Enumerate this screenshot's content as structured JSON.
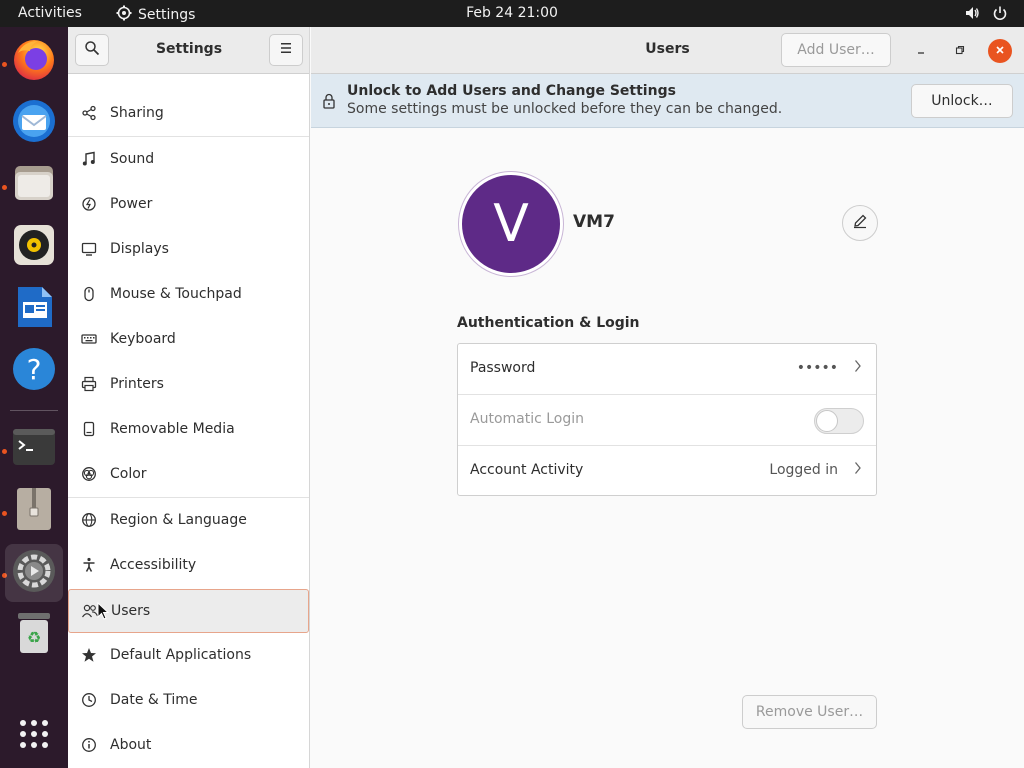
{
  "topbar": {
    "activities": "Activities",
    "app_name": "Settings",
    "clock": "Feb 24  21:00",
    "tray_icons": [
      "volume-icon",
      "power-icon"
    ]
  },
  "dock": {
    "items": [
      {
        "name": "Firefox",
        "icon": "firefox-icon",
        "running": true
      },
      {
        "name": "Thunderbird",
        "icon": "thunderbird-icon",
        "running": false
      },
      {
        "name": "Files",
        "icon": "files-icon",
        "running": true
      },
      {
        "name": "Rhythmbox",
        "icon": "rhythmbox-icon",
        "running": false
      },
      {
        "name": "LibreOffice Writer",
        "icon": "writer-icon",
        "running": false
      },
      {
        "name": "Help",
        "icon": "help-icon",
        "running": false
      },
      {
        "name": "Terminal",
        "icon": "terminal-icon",
        "running": true
      },
      {
        "name": "Archive Manager",
        "icon": "archive-icon",
        "running": true
      },
      {
        "name": "Settings",
        "icon": "settings-icon",
        "running": true,
        "active": true
      },
      {
        "name": "Trash",
        "icon": "trash-icon",
        "running": false
      }
    ],
    "show_apps": "app-grid-icon"
  },
  "sidebar": {
    "title": "Settings",
    "items": [
      {
        "label": "Sharing",
        "icon": "share-icon"
      },
      {
        "label": "Sound",
        "icon": "music-note-icon"
      },
      {
        "label": "Power",
        "icon": "power-icon"
      },
      {
        "label": "Displays",
        "icon": "display-icon"
      },
      {
        "label": "Mouse & Touchpad",
        "icon": "mouse-icon"
      },
      {
        "label": "Keyboard",
        "icon": "keyboard-icon"
      },
      {
        "label": "Printers",
        "icon": "printer-icon"
      },
      {
        "label": "Removable Media",
        "icon": "removable-media-icon"
      },
      {
        "label": "Color",
        "icon": "color-icon"
      },
      {
        "label": "Region & Language",
        "icon": "globe-icon"
      },
      {
        "label": "Accessibility",
        "icon": "accessibility-icon"
      },
      {
        "label": "Users",
        "icon": "users-icon",
        "selected": true
      },
      {
        "label": "Default Applications",
        "icon": "star-icon"
      },
      {
        "label": "Date & Time",
        "icon": "clock-icon"
      },
      {
        "label": "About",
        "icon": "info-icon"
      }
    ]
  },
  "main": {
    "title": "Users",
    "add_user": "Add User…",
    "infobar": {
      "title": "Unlock to Add Users and Change Settings",
      "subtitle": "Some settings must be unlocked before they can be changed.",
      "unlock": "Unlock…"
    },
    "user": {
      "initial": "V",
      "name": "VM7"
    },
    "auth": {
      "heading": "Authentication & Login",
      "rows": [
        {
          "label": "Password",
          "value": "•••••"
        },
        {
          "label": "Automatic Login",
          "toggle": false
        },
        {
          "label": "Account Activity",
          "value": "Logged in"
        }
      ]
    },
    "remove_user": "Remove User…"
  },
  "colors": {
    "accent": "#e95420",
    "avatar": "#5e2a87",
    "infobar": "#dfe9f1",
    "close_button": "#e95420"
  }
}
